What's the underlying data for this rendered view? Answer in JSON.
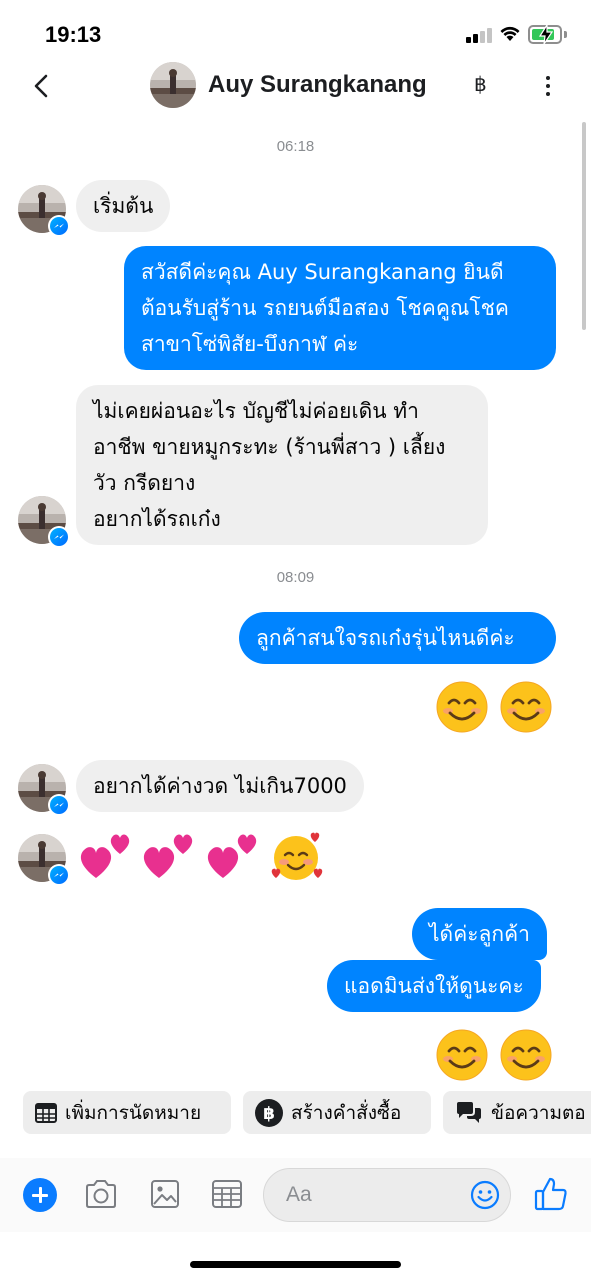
{
  "status_bar": {
    "time": "19:13"
  },
  "header": {
    "contact_name": "Auy Surangkanang",
    "currency_symbol": "฿"
  },
  "timestamps": [
    "06:18",
    "08:09"
  ],
  "messages": [
    {
      "from": "contact",
      "text": "เริ่มต้น"
    },
    {
      "from": "me",
      "text": "สวัสดีค่ะคุณ Auy Surangkanang ยินดี\nต้อนรับสู่ร้าน รถยนต์มือสอง โชคคูณโชค\nสาขาโซ่พิสัย-บึงกาฬ ค่ะ"
    },
    {
      "from": "contact",
      "text": "ไม่เคยผ่อนอะไร บัญชีไม่ค่อยเดิน ทำ\nอาชีพ ขายหมูกระทะ (ร้านพี่สาว ) เลี้ยง\nวัว กรีดยาง\nอยากได้รถเก๋ง"
    },
    {
      "from": "me",
      "text": "ลูกค้าสนใจรถเก๋งรุ่นไหนดีค่ะ"
    },
    {
      "from": "me",
      "emoji": "smiling-face-with-smiling-eyes x2"
    },
    {
      "from": "contact",
      "text": "อยากได้ค่างวด ไม่เกิน7000"
    },
    {
      "from": "contact",
      "emoji": "two-hearts x3, smiling-face-with-hearts"
    },
    {
      "from": "me",
      "text": "ได้ค่ะลูกค้า"
    },
    {
      "from": "me",
      "text": "แอดมินส่งให้ดูนะคะ"
    },
    {
      "from": "me",
      "emoji": "smiling-face-with-smiling-eyes x2"
    }
  ],
  "quick_replies": [
    {
      "label": "เพิ่มการนัดหมาย",
      "icon": "calendar-icon"
    },
    {
      "label": "สร้างคำสั่งซื้อ",
      "icon": "baht-icon"
    },
    {
      "label": "ข้อความตอ",
      "icon": "chat-bubbles-icon"
    }
  ],
  "composer": {
    "placeholder": "Aa"
  },
  "colors": {
    "accent": "#0084ff",
    "incoming_bubble": "#efefef",
    "outgoing_text": "#ffffff",
    "battery": "#32c759"
  }
}
